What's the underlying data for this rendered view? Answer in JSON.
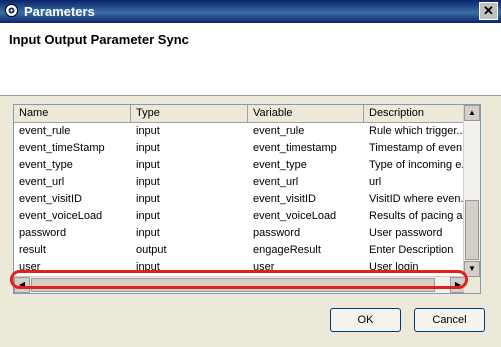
{
  "window": {
    "title": "Parameters",
    "close_glyph": "✕"
  },
  "header": {
    "heading": "Input Output Parameter Sync"
  },
  "table": {
    "columns": [
      "Name",
      "Type",
      "Variable",
      "Description"
    ],
    "rows": [
      [
        "event_rule",
        "input",
        "event_rule",
        "Rule which trigger..."
      ],
      [
        "event_timeStamp",
        "input",
        "event_timestamp",
        "Timestamp of even..."
      ],
      [
        "event_type",
        "input",
        "event_type",
        "Type of incoming e..."
      ],
      [
        "event_url",
        "input",
        "event_url",
        "url"
      ],
      [
        "event_visitID",
        "input",
        "event_visitID",
        "VisitID where even..."
      ],
      [
        "event_voiceLoad",
        "input",
        "event_voiceLoad",
        "Results of pacing a..."
      ],
      [
        "password",
        "input",
        "password",
        "User password"
      ],
      [
        "result",
        "output",
        "engageResult",
        "Enter Description"
      ],
      [
        "user",
        "input",
        "user",
        "User login"
      ]
    ],
    "highlighted_row": "event_url",
    "highlight_color": "#e3201b"
  },
  "scroll_arrows": {
    "up": "▲",
    "down": "▼",
    "left": "◀",
    "right": "▶"
  },
  "buttons": {
    "ok": "OK",
    "cancel": "Cancel"
  }
}
